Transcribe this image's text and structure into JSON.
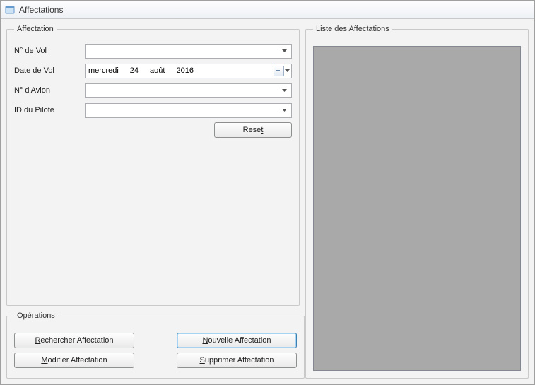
{
  "window": {
    "title": "Affectations"
  },
  "groups": {
    "affectation": {
      "legend": "Affectation"
    },
    "operations": {
      "legend": "Opérations"
    },
    "liste": {
      "legend": "Liste des Affectations"
    }
  },
  "form": {
    "numeroVol": {
      "label": "N° de Vol",
      "value": ""
    },
    "dateVol": {
      "label": "Date de Vol",
      "weekday": "mercredi",
      "day": "24",
      "month": "août",
      "year": "2016"
    },
    "numeroAvion": {
      "label": "N° d'Avion",
      "value": ""
    },
    "idPilote": {
      "label": "ID du Pilote",
      "value": ""
    }
  },
  "buttons": {
    "reset": {
      "mnemonic": "t",
      "pre": "Rese",
      "post": ""
    },
    "rechercher": {
      "mnemonic": "R",
      "pre": "",
      "post": "echercher Affectation"
    },
    "nouvelle": {
      "mnemonic": "N",
      "pre": "",
      "post": "ouvelle Affectation"
    },
    "modifier": {
      "mnemonic": "M",
      "pre": "",
      "post": "odifier Affectation"
    },
    "supprimer": {
      "mnemonic": "S",
      "pre": "",
      "post": "upprimer Affectation"
    }
  }
}
